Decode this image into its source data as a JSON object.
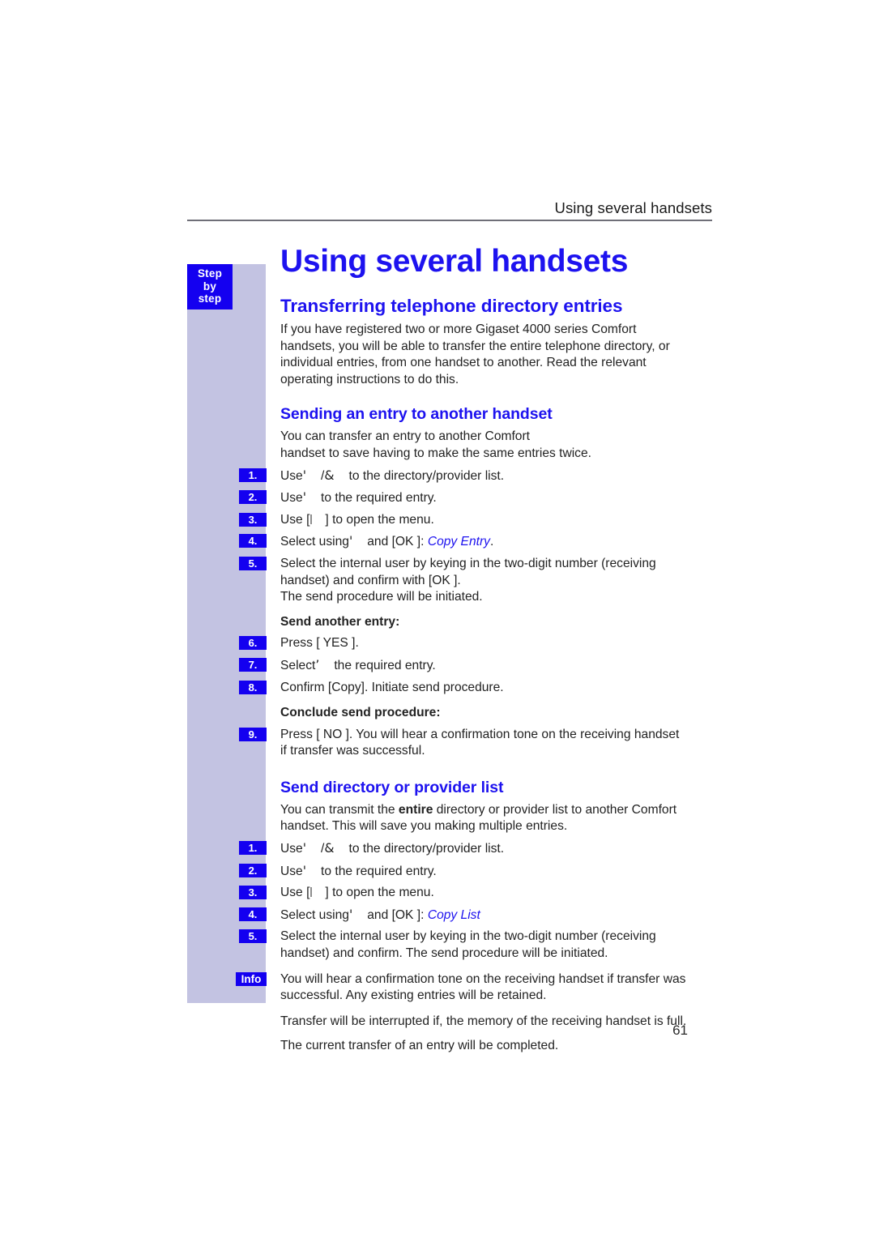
{
  "page": {
    "running_header": "Using several handsets",
    "page_number": "61",
    "sidebar_badge_lines": [
      "Step",
      "by",
      "step"
    ],
    "accent_blue": "#1d12ef",
    "badge_blue": "#1400f0",
    "sidebar_lavender": "#c3c3e2"
  },
  "chapter_title": "Using several handsets",
  "sections": [
    {
      "heading": "Transferring telephone directory entries",
      "intro": "If you have registered two or more Gigaset 4000 series Comfort handsets, you will be able to transfer the entire telephone directory, or individual entries, from one handset to another. Read the relevant operating instructions to do this."
    }
  ],
  "subsection_1": {
    "heading": "Sending an entry to another handset",
    "intro_line_1": "You can transfer an entry to another Comfort",
    "intro_line_2": "handset to save having to make the same entries twice.",
    "steps": [
      {
        "num": "1.",
        "pre": "Use",
        "sym": "'",
        "sep": "/",
        "sym2": "&",
        "post": "to the directory/provider list."
      },
      {
        "num": "2.",
        "pre": "Use",
        "sym": "'",
        "post": "to the required entry."
      },
      {
        "num": "3.",
        "pre": "Use [",
        "post": "] to open the menu."
      },
      {
        "num": "4.",
        "pre": "Select using",
        "sym": "'",
        "post": "and [OK ]:",
        "cmd": "Copy Entry",
        "tail": "."
      },
      {
        "num": "5.",
        "text": "Select the internal user by keying in the two-digit number (receiving handset) and confirm with [OK ]."
      }
    ],
    "after_step_5": "The send procedure will be initiated.",
    "lead_send_another": "Send another entry:",
    "steps_b": [
      {
        "num": "6.",
        "text": "Press [ YES  ]."
      },
      {
        "num": "7.",
        "pre": "Select",
        "sym": "’",
        "post": "the required entry."
      },
      {
        "num": "8.",
        "text": "Confirm [Copy]. Initiate send procedure."
      }
    ],
    "lead_conclude": "Conclude send procedure:",
    "steps_c": [
      {
        "num": "9.",
        "text": "Press [ NO   ]. You will hear a confirmation tone on the receiving handset if transfer was successful."
      }
    ]
  },
  "subsection_2": {
    "heading": "Send directory or provider list",
    "intro_pre": "You can transmit the ",
    "intro_bold": "entire",
    "intro_post": " directory or provider list to another Comfort handset. This will save you making multiple entries.",
    "steps": [
      {
        "num": "1.",
        "pre": "Use",
        "sym": "'",
        "sep": "/",
        "sym2": "&",
        "post": "to the directory/provider list."
      },
      {
        "num": "2.",
        "pre": "Use",
        "sym": "'",
        "post": "to the required entry."
      },
      {
        "num": "3.",
        "pre": "Use [",
        "post": "] to open the menu."
      },
      {
        "num": "4.",
        "pre": "Select using",
        "sym": "'",
        "post": "and [OK ]:",
        "cmd": "Copy List",
        "tail": ""
      },
      {
        "num": "5.",
        "text": "Select the internal user by keying in the two-digit number (receiving handset) and confirm. The send procedure will be initiated."
      }
    ]
  },
  "info_block": {
    "badge": "Info",
    "paragraph_1": "You will hear a confirmation tone on the receiving handset if transfer was successful. Any existing entries will be retained.",
    "paragraph_2": "Transfer will be interrupted if, the memory of the receiving handset is full.",
    "paragraph_3": "The current transfer of an entry will be completed."
  }
}
